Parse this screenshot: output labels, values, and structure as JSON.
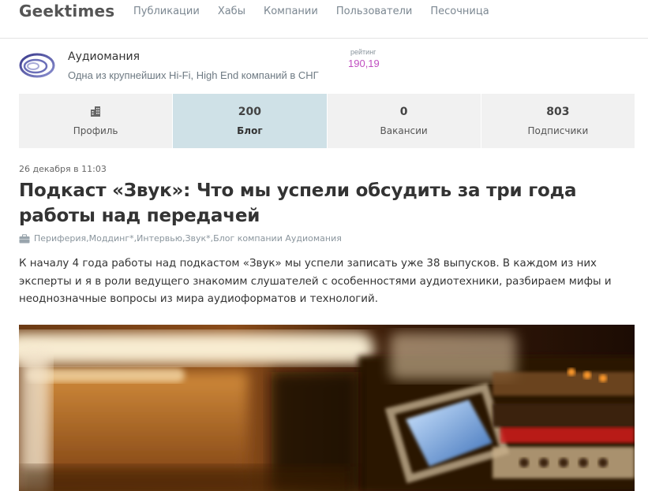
{
  "site": {
    "logo": "Geektimes"
  },
  "nav": {
    "items": [
      {
        "label": "Публикации"
      },
      {
        "label": "Хабы"
      },
      {
        "label": "Компании"
      },
      {
        "label": "Пользователи"
      },
      {
        "label": "Песочница"
      }
    ]
  },
  "company": {
    "name": "Аудиомания",
    "description": "Одна из крупнейших Hi-Fi, High End компаний в СНГ",
    "rating_label": "рейтинг",
    "rating_value": "190,19"
  },
  "tabs": [
    {
      "icon": "building-icon",
      "label": "Профиль"
    },
    {
      "count": "200",
      "label": "Блог",
      "active": true
    },
    {
      "count": "0",
      "label": "Вакансии"
    },
    {
      "count": "803",
      "label": "Подписчики"
    }
  ],
  "post": {
    "date": "26 декабря в 11:03",
    "title": "Подкаст «Звук»: Что мы успели обсудить за три года работы над передачей",
    "hubs": [
      {
        "label": "Периферия"
      },
      {
        "label": "Моддинг*"
      },
      {
        "label": "Интервью"
      },
      {
        "label": "Звук*"
      },
      {
        "label": "Блог компании Аудиомания"
      }
    ],
    "hub_separator": ", ",
    "text": "К началу 4 года работы над подкастом «Звук» мы успели записать уже 38 выпусков. В каждом из них эксперты и я в роли ведущего знакомим слушателей с особенностями аудиотехники, разбираем мифы и неоднозначные вопросы из мира аудиоформатов и технологий."
  },
  "colors": {
    "accent_tab": "#cfe1e7",
    "rating": "#c04fc1",
    "nav_text": "#7b8791"
  }
}
